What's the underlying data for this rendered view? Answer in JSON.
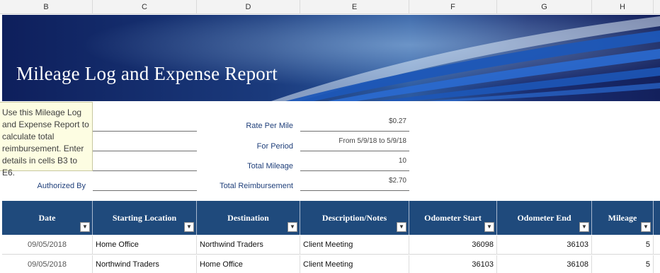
{
  "columns": [
    "B",
    "C",
    "D",
    "E",
    "F",
    "G",
    "H"
  ],
  "title": "Mileage Log and Expense Report",
  "note": "Use this Mileage Log and Expense Report to calculate total reimbursement. Enter details in cells B3 to E6.",
  "authorized_by_label": "Authorized By",
  "summary": {
    "rate_label": "Rate Per Mile",
    "rate_value": "$0.27",
    "period_label": "For Period",
    "period_value": "From 5/9/18 to 5/9/18",
    "total_mileage_label": "Total Mileage",
    "total_mileage_value": "10",
    "total_reimbursement_label": "Total Reimbursement",
    "total_reimbursement_value": "$2.70"
  },
  "table": {
    "headers": [
      "Date",
      "Starting Location",
      "Destination",
      "Description/Notes",
      "Odometer Start",
      "Odometer End",
      "Mileage"
    ],
    "rows": [
      [
        "09/05/2018",
        "Home Office",
        "Northwind Traders",
        "Client Meeting",
        "36098",
        "36103",
        "5"
      ],
      [
        "09/05/2018",
        "Northwind Traders",
        "Home Office",
        "Client Meeting",
        "36103",
        "36108",
        "5"
      ]
    ]
  },
  "colors": {
    "banner_dark": "#0e1f5c",
    "header_fill": "#1f4a7c",
    "label_blue": "#1f3f7a",
    "note_bg": "#fdfde2"
  }
}
